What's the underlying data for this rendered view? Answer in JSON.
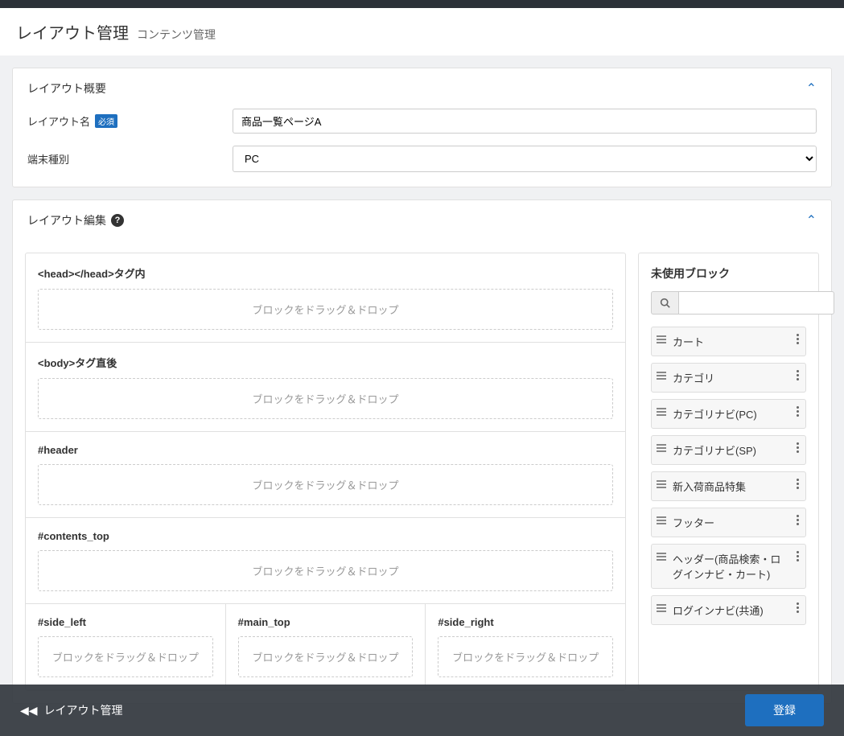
{
  "header": {
    "title": "レイアウト管理",
    "breadcrumb": "コンテンツ管理"
  },
  "overview": {
    "panel_title": "レイアウト概要",
    "fields": {
      "name_label": "レイアウト名",
      "required_badge": "必須",
      "name_value": "商品一覧ページA",
      "device_label": "端末種別",
      "device_value": "PC"
    }
  },
  "editor": {
    "panel_title": "レイアウト編集",
    "regions": [
      {
        "label": "<head></head>タグ内"
      },
      {
        "label": "<body>タグ直後"
      },
      {
        "label": "#header"
      },
      {
        "label": "#contents_top"
      }
    ],
    "columns": [
      {
        "label": "#side_left"
      },
      {
        "label": "#main_top"
      },
      {
        "label": "#side_right"
      }
    ],
    "dropzone_text": "ブロックをドラッグ＆ドロップ"
  },
  "unused": {
    "title": "未使用ブロック",
    "blocks": [
      "カート",
      "カテゴリ",
      "カテゴリナビ(PC)",
      "カテゴリナビ(SP)",
      "新入荷商品特集",
      "フッター",
      "ヘッダー(商品検索・ログインナビ・カート)",
      "ログインナビ(共通)"
    ]
  },
  "footer": {
    "back_label": "レイアウト管理",
    "submit_label": "登録"
  }
}
